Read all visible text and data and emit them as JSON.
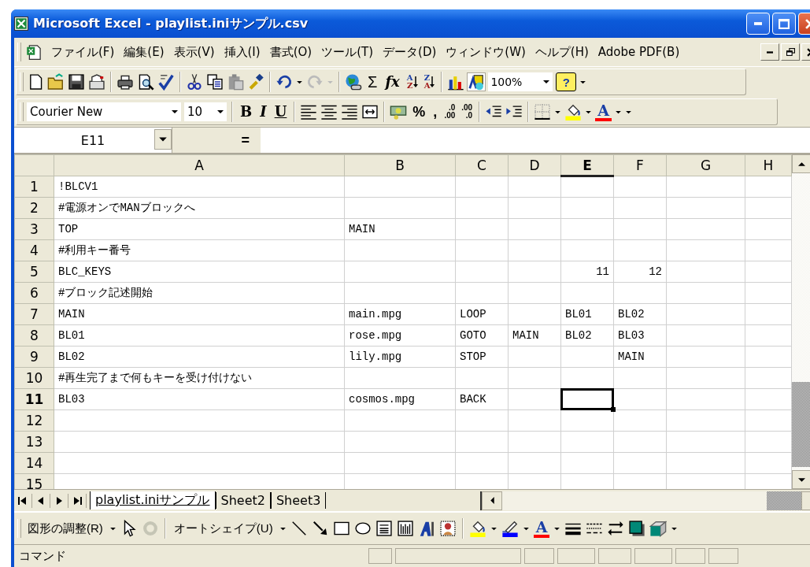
{
  "window": {
    "title": "Microsoft Excel - playlist.iniサンプル.csv"
  },
  "menu": [
    "ファイル(F)",
    "編集(E)",
    "表示(V)",
    "挿入(I)",
    "書式(O)",
    "ツール(T)",
    "データ(D)",
    "ウィンドウ(W)",
    "ヘルプ(H)",
    "Adobe PDF(B)"
  ],
  "standard_toolbar": {
    "sum": "Σ",
    "function": "fx",
    "sort_ascending": [
      "A",
      "Z"
    ],
    "sort_descending": [
      "Z",
      "A"
    ],
    "zoom": "100%",
    "help": "?"
  },
  "formatting_toolbar": {
    "font": "Courier New",
    "size": "10",
    "bold": "B",
    "italic": "I",
    "underline": "U",
    "percent": "%",
    "comma": ",",
    "increase_decimal": [
      ".0",
      ".00"
    ],
    "decrease_decimal": [
      ".00",
      ".0"
    ],
    "font_color": "A"
  },
  "formula_bar": {
    "name_box": "E11",
    "equals": "="
  },
  "columns": [
    {
      "label": "A",
      "selected": false
    },
    {
      "label": "B",
      "selected": false
    },
    {
      "label": "C",
      "selected": false
    },
    {
      "label": "D",
      "selected": false
    },
    {
      "label": "E",
      "selected": true
    },
    {
      "label": "F",
      "selected": false
    },
    {
      "label": "G",
      "selected": false
    },
    {
      "label": "H",
      "selected": false
    }
  ],
  "rows": [
    {
      "number": "1",
      "selected": false,
      "cells": [
        "!BLCV1"
      ]
    },
    {
      "number": "2",
      "selected": false,
      "cells": [
        "#電源オンでMANブロックへ"
      ]
    },
    {
      "number": "3",
      "selected": false,
      "cells": [
        "TOP",
        "MAIN"
      ]
    },
    {
      "number": "4",
      "selected": false,
      "cells": [
        "#利用キー番号"
      ]
    },
    {
      "number": "5",
      "selected": false,
      "cells": [
        "BLC_KEYS",
        null,
        null,
        null,
        {
          "text": "11",
          "kind": "number"
        },
        {
          "text": "12",
          "kind": "number"
        }
      ]
    },
    {
      "number": "6",
      "selected": false,
      "cells": [
        "#ブロック記述開始"
      ]
    },
    {
      "number": "7",
      "selected": false,
      "cells": [
        "MAIN",
        "main.mpg",
        "LOOP",
        null,
        "BL01",
        "BL02"
      ]
    },
    {
      "number": "8",
      "selected": false,
      "cells": [
        "BL01",
        "rose.mpg",
        "GOTO",
        "MAIN",
        "BL02",
        "BL03"
      ]
    },
    {
      "number": "9",
      "selected": false,
      "cells": [
        "BL02",
        "lily.mpg",
        "STOP",
        null,
        null,
        "MAIN"
      ]
    },
    {
      "number": "10",
      "selected": false,
      "cells": [
        "#再生完了まで何もキーを受け付けない"
      ]
    },
    {
      "number": "11",
      "selected": true,
      "cells": [
        "BL03",
        "cosmos.mpg",
        "BACK"
      ]
    },
    {
      "number": "12",
      "selected": false,
      "cells": []
    },
    {
      "number": "13",
      "selected": false,
      "cells": []
    },
    {
      "number": "14",
      "selected": false,
      "cells": []
    },
    {
      "number": "15",
      "selected": false,
      "cells": []
    }
  ],
  "sheet_tabs": [
    {
      "label": "playlist.iniサンプル",
      "selected": true
    },
    {
      "label": "Sheet2",
      "selected": false
    },
    {
      "label": "Sheet3",
      "selected": false
    }
  ],
  "drawing_toolbar": {
    "draw": "図形の調整(R)",
    "autoshapes": "オートシェイプ(U)",
    "font_color": "A"
  },
  "status_bar": {
    "text": "コマンド"
  }
}
